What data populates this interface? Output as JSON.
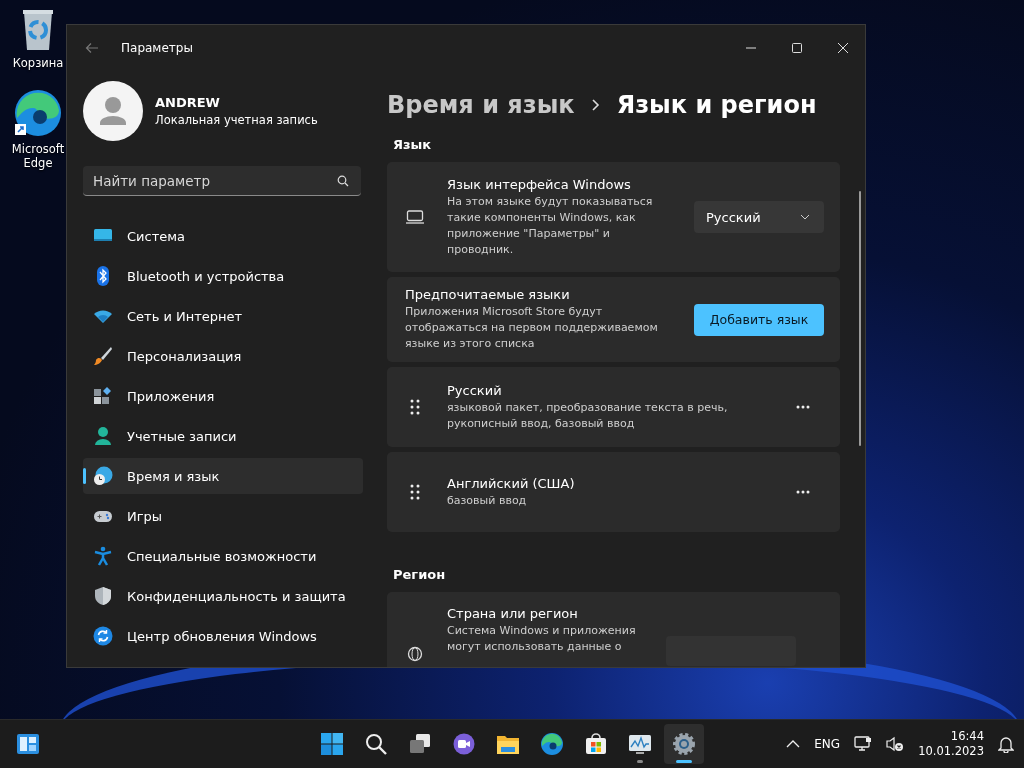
{
  "desktop_icons": [
    {
      "kind": "recycle-bin",
      "label": "Корзина"
    },
    {
      "kind": "edge",
      "label": "Microsoft Edge"
    }
  ],
  "window": {
    "title": "Параметры",
    "user": {
      "name": "ANDREW",
      "account_type": "Локальная учетная запись"
    },
    "search": {
      "placeholder": "Найти параметр"
    },
    "nav": [
      {
        "kind": "system",
        "label": "Система",
        "selected": false
      },
      {
        "kind": "bluetooth",
        "label": "Bluetooth и устройства",
        "selected": false
      },
      {
        "kind": "network",
        "label": "Сеть и Интернет",
        "selected": false
      },
      {
        "kind": "personalization",
        "label": "Персонализация",
        "selected": false
      },
      {
        "kind": "apps",
        "label": "Приложения",
        "selected": false
      },
      {
        "kind": "accounts",
        "label": "Учетные записи",
        "selected": false
      },
      {
        "kind": "time",
        "label": "Время и язык",
        "selected": true
      },
      {
        "kind": "gaming",
        "label": "Игры",
        "selected": false
      },
      {
        "kind": "accessibility",
        "label": "Специальные возможности",
        "selected": false
      },
      {
        "kind": "privacy",
        "label": "Конфиденциальность и защита",
        "selected": false
      },
      {
        "kind": "update",
        "label": "Центр обновления Windows",
        "selected": false
      }
    ],
    "breadcrumb": [
      "Время и язык",
      "Язык и регион"
    ],
    "language_section": {
      "heading": "Язык",
      "display_language": {
        "title": "Язык интерфейса Windows",
        "description": "На этом языке будут показываться такие компоненты Windows, как приложение \"Параметры\" и проводник.",
        "value": "Русский"
      },
      "preferred": {
        "title": "Предпочитаемые языки",
        "description": "Приложения Microsoft Store будут отображаться на первом поддерживаемом языке из этого списка",
        "button": "Добавить язык"
      },
      "languages": [
        {
          "name": "Русский",
          "features": "языковой пакет, преобразование текста в речь, рукописный ввод, базовый ввод"
        },
        {
          "name": "Английский (США)",
          "features": "базовый ввод"
        }
      ]
    },
    "region_section": {
      "heading": "Регион",
      "country": {
        "title": "Страна или регион",
        "description": "Система Windows и приложения могут использовать данные о"
      }
    }
  },
  "taskbar": {
    "apps": [
      {
        "kind": "start",
        "running": false,
        "selected": false
      },
      {
        "kind": "search",
        "running": false,
        "selected": false
      },
      {
        "kind": "task-view",
        "running": false,
        "selected": false
      },
      {
        "kind": "chat",
        "running": false,
        "selected": false
      },
      {
        "kind": "explorer",
        "running": false,
        "selected": false
      },
      {
        "kind": "edge",
        "running": false,
        "selected": false
      },
      {
        "kind": "store",
        "running": false,
        "selected": false
      },
      {
        "kind": "monitor",
        "running": true,
        "selected": false
      },
      {
        "kind": "settings",
        "running": true,
        "selected": true
      }
    ],
    "language": "ENG",
    "time": "16:44",
    "date": "10.01.2023"
  }
}
